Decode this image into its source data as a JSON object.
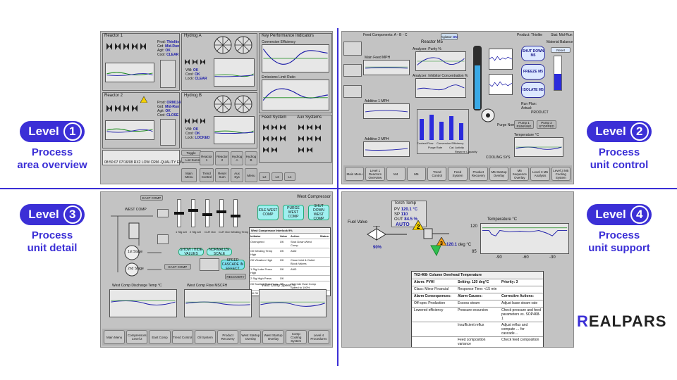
{
  "levels": [
    {
      "label": "Level",
      "num": "1",
      "line1": "Process",
      "line2": "area overview"
    },
    {
      "label": "Level",
      "num": "2",
      "line1": "Process",
      "line2": "unit control"
    },
    {
      "label": "Level",
      "num": "3",
      "line1": "Process",
      "line2": "unit detail"
    },
    {
      "label": "Level",
      "num": "4",
      "line1": "Process",
      "line2": "unit support"
    }
  ],
  "brand": {
    "prefix": "R",
    "rest": "EALPARS",
    "accent": "#3b2fd6"
  },
  "p1": {
    "reactor1": "Reactor 1",
    "reactor2": "Reactor 2",
    "hydrogA": "Hydrog A",
    "hydrogB": "Hydrog B",
    "kpi": "Key Performance Indicators",
    "conv": "Conversion Efficiency",
    "emis": "Emissions Limit Ratio",
    "feed": "Feed System",
    "aux": "Aux Systems",
    "prod1": "Thiolite",
    "grade1": "Mid-Run",
    "prod2": "ORM114",
    "grade2": "Mid-Run",
    "ok": "OK",
    "close": "CLOSE",
    "clear": "CLEAR",
    "lock": "LOCKED",
    "alarm": "08:50:07 07/16/08 RX2 LOW CRM -QUALITY EXC",
    "toggle": "Toggle",
    "list": "List Summary",
    "nav": [
      "Main Menu",
      "Reactor 1",
      "Reactor 2",
      "Hydrog A",
      "Hydrog B",
      "Trend Control",
      "Reset Sum",
      "Aux Sys",
      "Menu",
      "L2",
      "L3",
      "L4"
    ]
  },
  "p2": {
    "feed": "Feed Components: A - B - C",
    "reactor": "Reactor M5",
    "agitator": "Agitator",
    "agitator_val": "ON",
    "product": "Product: Thiolite",
    "stat": "Stat: Mid-Run",
    "material": "Material Balance",
    "shutdown": "SHUT DOWN M5",
    "freeze": "FREEZE M5",
    "isolate": "ISOLATE M5",
    "reset": "Reset",
    "run_plan": "Run Plan:",
    "actual": "Actual:",
    "purity": "Analyzer: Purity %",
    "inhibitor": "Analyzer: Inhibitor Concentration %",
    "mainfeed": "Main Feed MPH",
    "additive1": "Additive 1 MPH",
    "additive2": "Additive 2 MPH",
    "temperature": "Temperature °C",
    "cooling": "COOLING SYS",
    "purge": "Purge Nominal",
    "pump1": "Pump 1 RUNNING",
    "pump2": "Pump 2 STOPPED",
    "product_out": "PRODUCT",
    "bars": [
      "Coolant Flow",
      "Purge Rate",
      "Conversion Efficiency",
      "Cat. Activity",
      "Reserve Capacity"
    ],
    "nav": [
      "Main Menu",
      "Level 1 Reactors Overview",
      "M4",
      "M6",
      "Trend Control",
      "Feed System",
      "Product Recovery",
      "M5 Startup Overlay",
      "M5 Sequence Overlay",
      "Level 3 M5 Analysis",
      "Level 3 M5 Cooling System"
    ]
  },
  "p3": {
    "title": "West Compressor",
    "idle": "IDLE WEST COMP",
    "purge": "PURGE WEST COMP",
    "shutdown": "SHUT DOWN WEST COMP",
    "eastcomp": "EAST COMP",
    "westcomp": "WEST COMP ",
    "stage1": "1st Stage",
    "stage2": "2nd Stage",
    "show": "SHOW / HIDE VALUES",
    "normalize": "NORMALIZE SCALE",
    "speed": "SPEED CASCADE IN EFFECT",
    "interlock": "West Compressor Interlock 9%",
    "recovery": "RECOVERY",
    "sliders": [
      "1 Stg set",
      "2 Stg set",
      "CLR Out",
      "CLR Out",
      "Winding Temp"
    ],
    "interlock_rows": [
      [
        "Overspeed",
        "OK",
        "Shut Down West Comp"
      ],
      [
        "Oil Winding Temp High",
        "OK",
        "AND"
      ],
      [
        "Oil Vibration High",
        "OK",
        "Close Inlet & Outlet Block Valves"
      ],
      [
        "1 Stg Lube Press High",
        "OK",
        "AND"
      ],
      [
        "2 Stg High Press",
        "OK",
        ""
      ],
      [
        "Oil Suction Press Low",
        "OK",
        "Override East Comp Speed to 100%"
      ],
      [
        "Oil Oil Pres Low",
        "OK",
        ""
      ]
    ],
    "interlock_cols": [
      "Initiator",
      "Value",
      "Action",
      "Status"
    ],
    "trend1": "West Comp Discharge Temp °C",
    "trend2": "West Comp Flow MSCFH",
    "trend3": "West Comp Speed %",
    "nav": [
      "Main Menu",
      "Compressors Level 2",
      "East Comp",
      "Trend Control",
      "Oil System",
      "Product Recovery",
      "West Startup Overlay",
      "West Startup Overlay",
      "Comp Cooling System",
      "Level 4 Procedures"
    ]
  },
  "p4": {
    "fuel": "Fuel Valve",
    "fuel_pct": "90%",
    "torch": "Torch Temp",
    "pv": "PV",
    "pv_val": "120.1",
    "pv_unit": "°C",
    "sp": "SP",
    "sp_val": "110",
    "out": "OUT",
    "out_val": "84.5",
    "out_unit": "%",
    "auto": "AUTO",
    "tip": "120.1",
    "tip_unit": "deg °C",
    "trend_title": "Temperature °C",
    "ymax": "120",
    "ymin": "85",
    "xticks": [
      "-90",
      "-60",
      "-30"
    ],
    "table_title": "T02-468- Column Overhead Temperature",
    "rows": [
      [
        "Alarm: PVHI",
        "Setting: 120 deg°C",
        "Priority: 3"
      ],
      [
        "Class: Minor Financial",
        "Response Time: <15 min",
        ""
      ],
      [
        "Alarm Consequences:",
        "Alarm Causes:",
        "Corrective Actions:"
      ],
      [
        "Off-spec Production",
        "Excess steam",
        "Adjust base steam rate"
      ],
      [
        "Lowered efficiency",
        "Pressure excursion",
        "Check pressure and feed parameters vs. SOP468-1"
      ],
      [
        "",
        "Insufficient reflux",
        "Adjust reflux and compute … for cascade…"
      ],
      [
        "",
        "Feed composition variance",
        "Check feed composition"
      ]
    ]
  }
}
